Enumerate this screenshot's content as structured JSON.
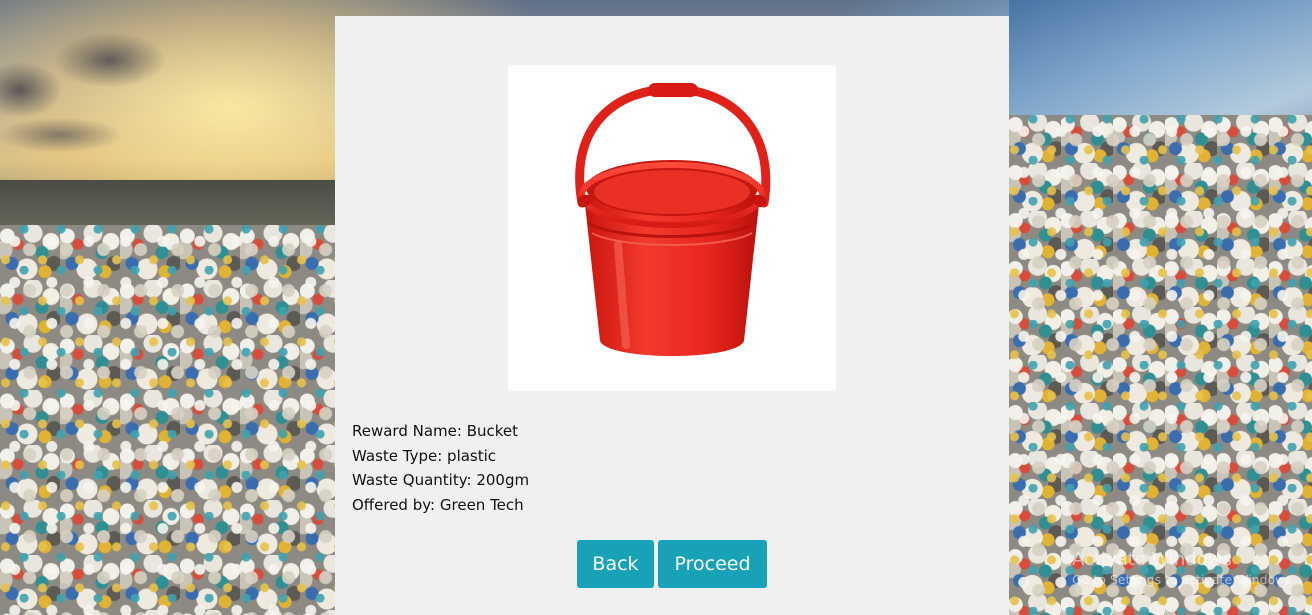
{
  "reward": {
    "image_alt": "Bucket",
    "image_color": "#e8261f",
    "details": [
      {
        "label": "Reward Name:",
        "value": "Bucket"
      },
      {
        "label": "Waste Type:",
        "value": "plastic"
      },
      {
        "label": "Waste Quantity:",
        "value": "200gm"
      },
      {
        "label": "Offered by:",
        "value": "Green Tech"
      }
    ]
  },
  "actions": {
    "back_label": "Back",
    "proceed_label": "Proceed",
    "button_color": "#17a2b8"
  },
  "watermark": {
    "title": "Activate Windows",
    "subtitle": "Go to Settings to activate Windows."
  }
}
